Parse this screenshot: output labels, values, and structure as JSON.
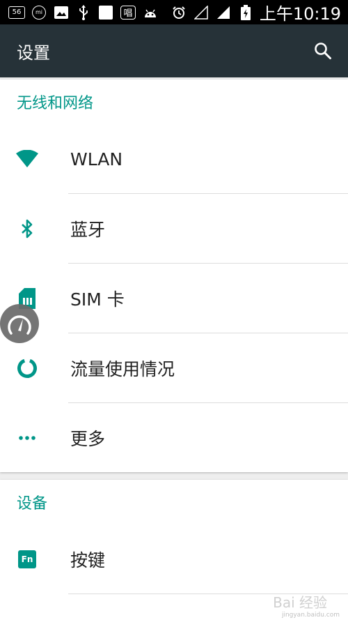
{
  "status_bar": {
    "badge": "56",
    "mi_label": "mi",
    "sing_label": "唱",
    "time": "上午10:19"
  },
  "toolbar": {
    "title": "设置"
  },
  "sections": [
    {
      "title": "无线和网络",
      "items": [
        {
          "label": "WLAN",
          "icon": "wifi-icon"
        },
        {
          "label": "蓝牙",
          "icon": "bluetooth-icon"
        },
        {
          "label": "SIM 卡",
          "icon": "sim-card-icon"
        },
        {
          "label": "流量使用情况",
          "icon": "data-usage-icon"
        },
        {
          "label": "更多",
          "icon": "more-dots-icon"
        }
      ]
    },
    {
      "title": "设备",
      "items": [
        {
          "label": "按键",
          "icon": "fn-key-icon",
          "icon_text": "Fn"
        }
      ]
    }
  ],
  "watermark": {
    "text": "Bai 经验",
    "sub": "jingyan.baidu.com"
  },
  "colors": {
    "accent": "#009688",
    "toolbar": "#263238",
    "status_bar": "#000000"
  }
}
